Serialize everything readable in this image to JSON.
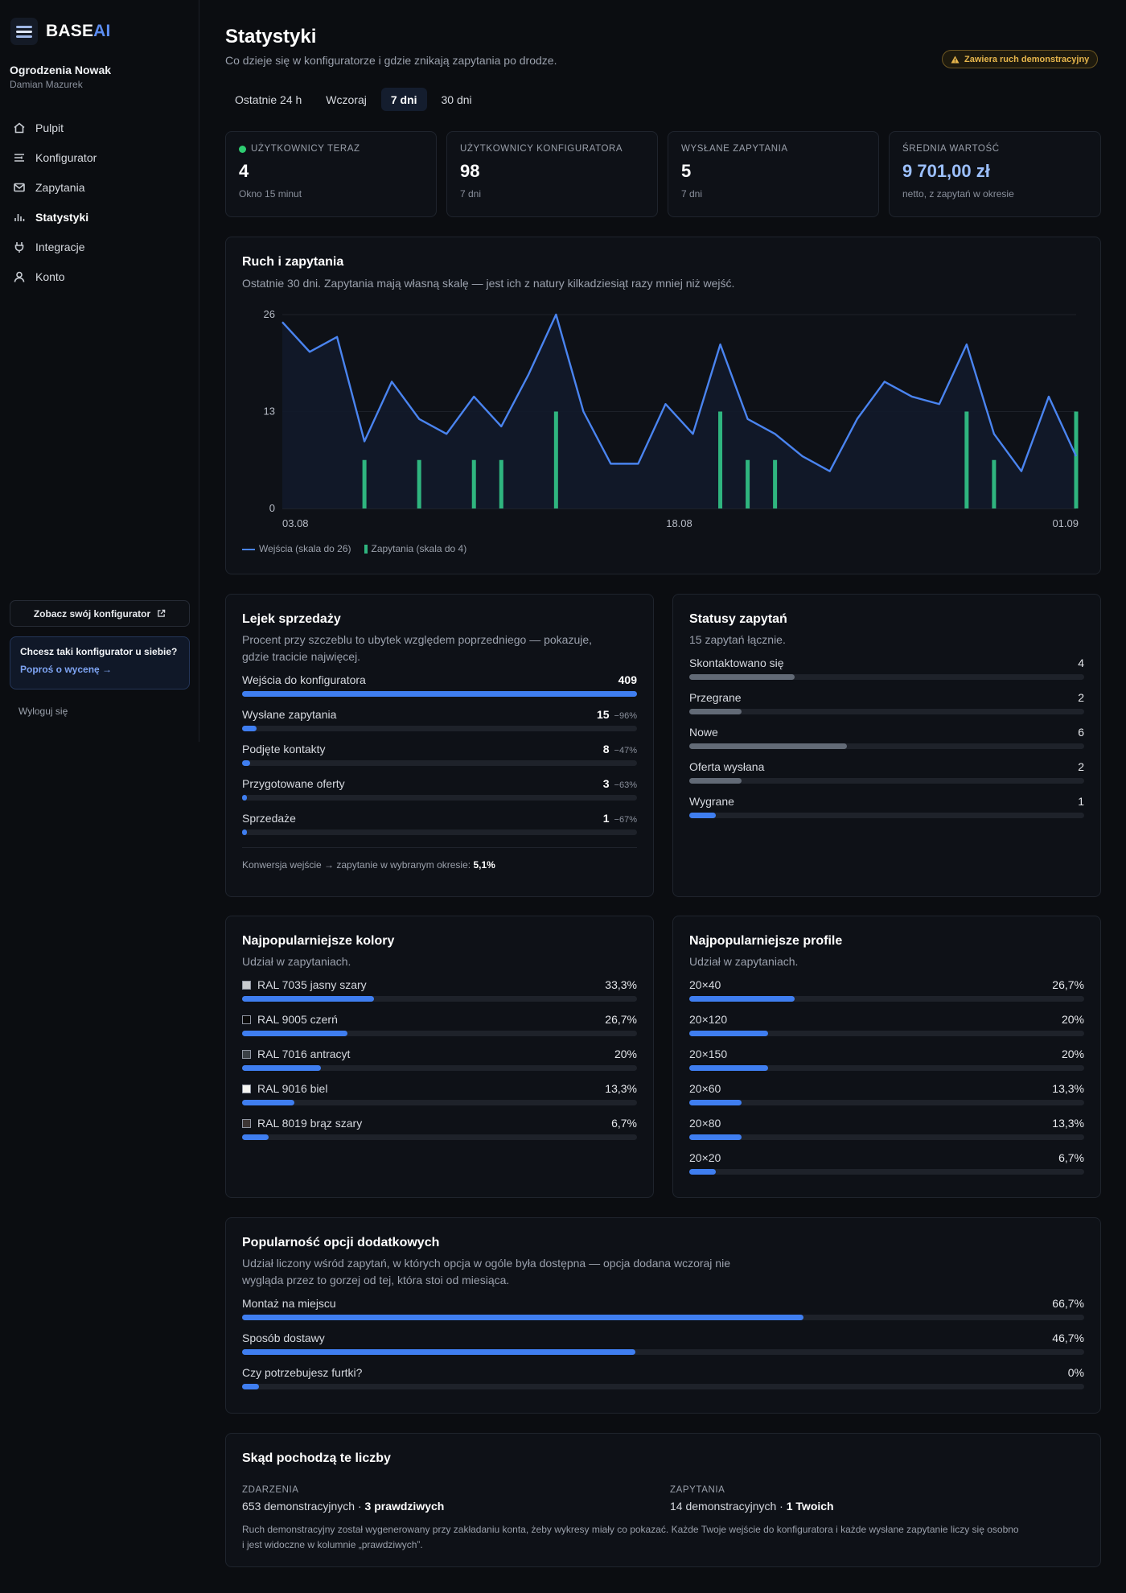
{
  "app": {
    "logo_main": "BASE",
    "logo_accent": "AI",
    "org_name": "Ogrodzenia Nowak",
    "user_name": "Damian Mazurek"
  },
  "nav": [
    {
      "label": "Pulpit",
      "icon": "home-icon"
    },
    {
      "label": "Konfigurator",
      "icon": "sliders-icon"
    },
    {
      "label": "Zapytania",
      "icon": "mail-icon"
    },
    {
      "label": "Statystyki",
      "icon": "bar-chart-icon",
      "active": true
    },
    {
      "label": "Integracje",
      "icon": "plug-icon"
    },
    {
      "label": "Konto",
      "icon": "user-icon"
    }
  ],
  "sidebar": {
    "see_configurator": "Zobacz swój konfigurator",
    "promo_title": "Chcesz taki konfigurator u siebie?",
    "promo_link": "Poproś o wycenę →",
    "logout": "Wyloguj się"
  },
  "header": {
    "title": "Statystyki",
    "subtitle": "Co dzieje się w konfiguratorze i gdzie znikają zapytania po drodze.",
    "demo_badge": "Zawiera ruch demonstracyjny"
  },
  "tabs": [
    {
      "label": "Ostatnie 24 h"
    },
    {
      "label": "Wczoraj"
    },
    {
      "label": "7 dni",
      "active": true
    },
    {
      "label": "30 dni"
    }
  ],
  "kpis": [
    {
      "label": "UŻYTKOWNICY TERAZ",
      "value": "4",
      "note": "Okno 15 minut",
      "live": true
    },
    {
      "label": "UŻYTKOWNICY KONFIGURATORA",
      "value": "98",
      "note": "7 dni"
    },
    {
      "label": "WYSŁANE ZAPYTANIA",
      "value": "5",
      "note": "7 dni"
    },
    {
      "label": "ŚREDNIA WARTOŚĆ",
      "value": "9 701,00 zł",
      "note": "netto, z zapytań w okresie",
      "accent": true
    }
  ],
  "traffic": {
    "title": "Ruch i zapytania",
    "subtitle": "Ostatnie 30 dni. Zapytania mają własną skalę — jest ich z natury kilkadziesiąt razy mniej niż wejść.",
    "legend_visits": "Wejścia (skala do 26)",
    "legend_inquiries": "Zapytania (skala do 4)"
  },
  "chart_data": {
    "type": "line",
    "title": "Ruch i zapytania",
    "y_ticks": [
      "26",
      "13",
      "0"
    ],
    "x_ticks": [
      "03.08",
      "18.08",
      "01.09"
    ],
    "ylim": [
      0,
      26
    ],
    "y2lim": [
      0,
      4
    ],
    "grid": true,
    "legend_position": "bottom-left",
    "series": [
      {
        "name": "Wejścia (skala do 26)",
        "type": "area-line",
        "color": "#4a84f0",
        "values": [
          25,
          21,
          23,
          9,
          17,
          12,
          10,
          15,
          11,
          18,
          26,
          13,
          6,
          6,
          14,
          10,
          22,
          12,
          10,
          7,
          5,
          12,
          17,
          15,
          14,
          22,
          10,
          5,
          15,
          7
        ]
      },
      {
        "name": "Zapytania (skala do 4)",
        "type": "bar",
        "color": "#2fb57f",
        "values": [
          0,
          0,
          0,
          1,
          0,
          1,
          0,
          1,
          1,
          0,
          2,
          0,
          0,
          0,
          0,
          0,
          2,
          1,
          1,
          0,
          0,
          0,
          0,
          0,
          0,
          2,
          1,
          0,
          0,
          2
        ]
      }
    ]
  },
  "funnel": {
    "title": "Lejek sprzedaży",
    "subtitle_1": "Procent przy szczeblu to ubytek względem poprzedniego — pokazuje,",
    "subtitle_2": "gdzie tracicie najwięcej.",
    "rows": [
      {
        "label": "Wejścia do konfiguratora",
        "value": "409",
        "delta": "",
        "fraction": 1.0
      },
      {
        "label": "Wysłane zapytania",
        "value": "15",
        "delta": "−96%",
        "fraction": 0.037
      },
      {
        "label": "Podjęte kontakty",
        "value": "8",
        "delta": "−47%",
        "fraction": 0.02
      },
      {
        "label": "Przygotowane oferty",
        "value": "3",
        "delta": "−63%",
        "fraction": 0.012
      },
      {
        "label": "Sprzedaże",
        "value": "1",
        "delta": "−67%",
        "fraction": 0.012
      }
    ],
    "conversion_text": "Konwersja wejście → zapytanie w wybranym okresie:",
    "conversion_value": "5,1%"
  },
  "statuses": {
    "title": "Statusy zapytań",
    "subtitle": "15 zapytań łącznie.",
    "rows": [
      {
        "label": "Skontaktowano się",
        "value": "4",
        "fraction": 0.267,
        "color": "#626a76"
      },
      {
        "label": "Przegrane",
        "value": "2",
        "fraction": 0.133,
        "color": "#626a76"
      },
      {
        "label": "Nowe",
        "value": "6",
        "fraction": 0.4,
        "color": "#626a76"
      },
      {
        "label": "Oferta wysłana",
        "value": "2",
        "fraction": 0.133,
        "color": "#626a76"
      },
      {
        "label": "Wygrane",
        "value": "1",
        "fraction": 0.067,
        "color": "#3f7ef0"
      }
    ]
  },
  "colors": {
    "title": "Najpopularniejsze kolory",
    "subtitle": "Udział w zapytaniach.",
    "rows": [
      {
        "label": "RAL 7035 jasny szary",
        "value": "33,3%",
        "fraction": 0.333,
        "swatch": "#c9ccd0"
      },
      {
        "label": "RAL 9005 czerń",
        "value": "26,7%",
        "fraction": 0.267,
        "swatch": "#0a0a0a"
      },
      {
        "label": "RAL 7016 antracyt",
        "value": "20%",
        "fraction": 0.2,
        "swatch": "#3b4146"
      },
      {
        "label": "RAL 9016 biel",
        "value": "13,3%",
        "fraction": 0.133,
        "swatch": "#f5f5f2"
      },
      {
        "label": "RAL 8019 brąz szary",
        "value": "6,7%",
        "fraction": 0.067,
        "swatch": "#3d3634"
      }
    ]
  },
  "profiles": {
    "title": "Najpopularniejsze profile",
    "subtitle": "Udział w zapytaniach.",
    "rows": [
      {
        "label": "20×40",
        "value": "26,7%",
        "fraction": 0.267
      },
      {
        "label": "20×120",
        "value": "20%",
        "fraction": 0.2
      },
      {
        "label": "20×150",
        "value": "20%",
        "fraction": 0.2
      },
      {
        "label": "20×60",
        "value": "13,3%",
        "fraction": 0.133
      },
      {
        "label": "20×80",
        "value": "13,3%",
        "fraction": 0.133
      },
      {
        "label": "20×20",
        "value": "6,7%",
        "fraction": 0.067
      }
    ]
  },
  "options": {
    "title": "Popularność opcji dodatkowych",
    "subtitle_1": "Udział liczony wśród zapytań, w których opcja w ogóle była dostępna — opcja dodana wczoraj nie",
    "subtitle_2": "wygląda przez to gorzej od tej, która stoi od miesiąca.",
    "rows": [
      {
        "label": "Montaż na miejscu",
        "value": "66,7%",
        "fraction": 0.667
      },
      {
        "label": "Sposób dostawy",
        "value": "46,7%",
        "fraction": 0.467
      },
      {
        "label": "Czy potrzebujesz furtki?",
        "value": "0%",
        "fraction": 0.02
      }
    ]
  },
  "sources": {
    "title": "Skąd pochodzą te liczby",
    "events_label": "ZDARZENIA",
    "events_demo": "653 demonstracyjnych · ",
    "events_real": "3 prawdziwych",
    "inquiries_label": "ZAPYTANIA",
    "inquiries_demo": "14 demonstracyjnych · ",
    "inquiries_real": "1 Twoich",
    "note_1": "Ruch demonstracyjny został wygenerowany przy zakładaniu konta, żeby wykresy miały co pokazać. Każde Twoje wejście do konfiguratora i każde wysłane zapytanie liczy się osobno",
    "note_2": "i jest widoczne w kolumnie „prawdziwych”."
  }
}
